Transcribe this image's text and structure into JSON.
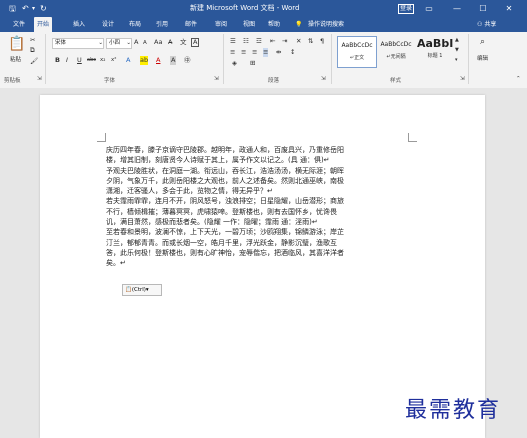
{
  "titlebar": {
    "title": "新建 Microsoft Word 文档 - Word",
    "save_icon": "save-icon",
    "undo_icon": "undo-icon",
    "redo_icon": "redo-icon",
    "quick_access_more": "▾"
  },
  "tabs": [
    "文件",
    "开始",
    "插入",
    "设计",
    "布局",
    "引用",
    "邮件",
    "审阅",
    "视图",
    "帮助",
    "操作说明搜索"
  ],
  "active_tab": "开始",
  "share_label": "共享",
  "ribbon": {
    "clipboard": {
      "paste_label": "粘贴",
      "group_label": "剪贴板"
    },
    "font": {
      "font_name": "宋体",
      "font_size": "小四",
      "grow": "A",
      "shrink": "A",
      "case": "Aa",
      "bold": "B",
      "italic": "I",
      "underline": "U",
      "strike": "abc",
      "subscript": "x₂",
      "superscript": "x²",
      "group_label": "字体"
    },
    "paragraph": {
      "group_label": "段落"
    },
    "styles": {
      "items": [
        {
          "preview": "AaBbCcDc",
          "name": "↵正文"
        },
        {
          "preview": "AaBbCcDc",
          "name": "↵无间隔"
        },
        {
          "preview": "AaBbI",
          "name": "标题 1"
        }
      ],
      "group_label": "样式"
    },
    "editing": {
      "label": "编辑"
    }
  },
  "document": {
    "lines": [
      "庆历四年春，滕子京谪守巴陵郡。越明年，政通人和，百废具兴，乃重修岳阳",
      "楼，增其旧制，刻唐贤今人诗赋于其上，属予作文以记之。(具  通：俱)↵",
      "予观夫巴陵胜状，在洞庭一湖。衔远山，吞长江，浩浩汤汤，横无际涯；朝晖",
      "夕阴，气象万千，此则岳阳楼之大观也，前人之述备矣。然则北通巫峡，南极",
      "潇湘，迁客骚人，多会于此，览物之情，得无异乎？↵",
      "若夫霪雨霏霏，连月不开，阴风怒号，浊浪排空；日星隐耀，山岳潜形；商旅",
      "不行，樯倾楫摧；薄暮冥冥，虎啸猿啼。登斯楼也，则有去国怀乡，忧谗畏",
      "讥，满目萧然，感极而悲者矣。(隐耀  一作：隐曜；霪雨  通：淫雨)↵",
      "至若春和景明，波澜不惊，上下天光，一碧万顷；沙鸥翔集，锦鳞游泳；岸芷",
      "汀兰，郁郁青青。而或长烟一空，皓月千里，浮光跃金，静影沉璧，渔歌互",
      "答，此乐何极！登斯楼也，则有心旷神怡，宠辱偕忘，把酒临风，其喜洋洋者",
      "矣。↵"
    ],
    "paste_options": "(Ctrl)▾"
  },
  "watermark": "最需教育"
}
